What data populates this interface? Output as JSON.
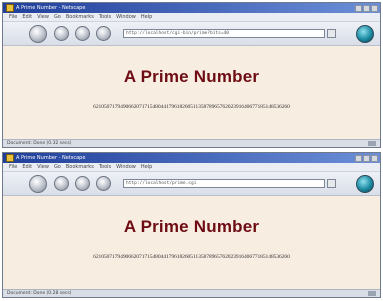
{
  "windows": [
    {
      "title": "A Prime Number - Netscape",
      "menu": [
        "File",
        "Edit",
        "View",
        "Go",
        "Bookmarks",
        "Tools",
        "Window",
        "Help"
      ],
      "url": "http://localhost/cgi-bin/prime?bits=40",
      "heading": "A Prime Number",
      "prime": "6210507179490662071715480441796182605113587896576202391640677185148536260",
      "status": "Document: Done (0.32 secs)"
    },
    {
      "title": "A Prime Number - Netscape",
      "menu": [
        "File",
        "Edit",
        "View",
        "Go",
        "Bookmarks",
        "Tools",
        "Window",
        "Help"
      ],
      "url": "http://localhost/prime.cgi",
      "heading": "A Prime Number",
      "prime": "6210507179490662071715480441796182605113587896576202391640677185148536260",
      "status": "Document: Done (0.28 secs)"
    }
  ]
}
